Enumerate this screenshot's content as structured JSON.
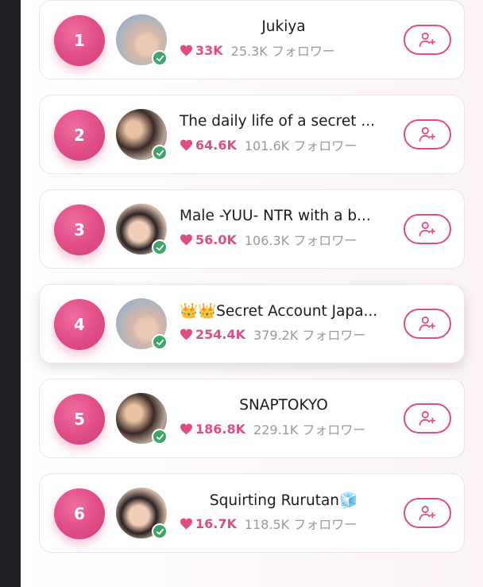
{
  "colors": {
    "accent": "#e04c86",
    "verified": "#3fa66b",
    "muted": "#9a9a9a",
    "sidebar": "#1f2127"
  },
  "ranking": [
    {
      "rank": "1",
      "name": "Jukiya",
      "likes": "33K",
      "followers": "25.3K フォロワー"
    },
    {
      "rank": "2",
      "name": "The daily life of a secret ...",
      "likes": "64.6K",
      "followers": "101.6K フォロワー"
    },
    {
      "rank": "3",
      "name": "Male -YUU- NTR with a b...",
      "likes": "56.0K",
      "followers": "106.3K フォロワー"
    },
    {
      "rank": "4",
      "name": "👑👑Secret Account Japa...",
      "likes": "254.4K",
      "followers": "379.2K フォロワー"
    },
    {
      "rank": "5",
      "name": "SNAPTOKYO",
      "likes": "186.8K",
      "followers": "229.1K フォロワー"
    },
    {
      "rank": "6",
      "name": "Squirting Rurutan🧊",
      "likes": "16.7K",
      "followers": "118.5K フォロワー"
    }
  ],
  "icons": {
    "like": "heart-icon",
    "verified": "check-icon",
    "follow": "user-plus-icon"
  }
}
